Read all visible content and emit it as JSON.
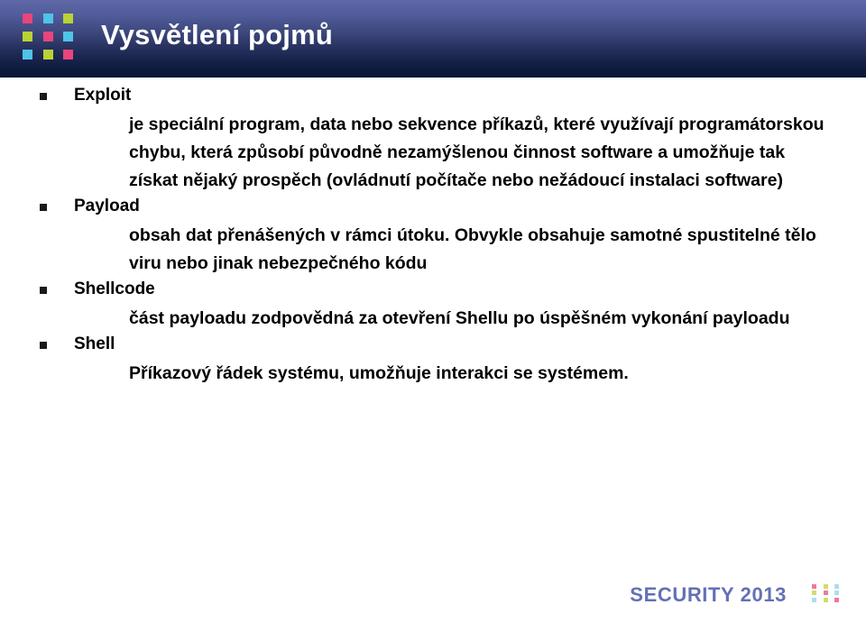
{
  "slide": {
    "header": {
      "title": "Vysvětlení pojmů",
      "logo_name": "dot-grid-logo",
      "logo_colors": [
        [
          "#e8457c",
          "#4fc3e8",
          "#b9d234"
        ],
        [
          "#b9d234",
          "#e8457c",
          "#4fc3e8"
        ],
        [
          "#4fc3e8",
          "#b9d234",
          "#e8457c"
        ]
      ],
      "gradient_top": "#5e68a6",
      "gradient_bottom": "#0a1733",
      "title_color": "#ffffff"
    },
    "terms": [
      {
        "term": "Exploit",
        "definition": "je speciální program, data nebo sekvence příkazů, které využívají programátorskou chybu, která způsobí původně nezamýšlenou činnost software a umožňuje tak získat nějaký prospěch (ovládnutí počítače nebo nežádoucí instalaci software)"
      },
      {
        "term": "Payload",
        "definition": "obsah dat přenášených v rámci útoku. Obvykle obsahuje samotné spustitelné tělo viru nebo jinak nebezpečného kódu"
      },
      {
        "term": "Shellcode",
        "definition": "část payloadu zodpovědná za otevření Shellu po úspěšném vykonání payloadu"
      },
      {
        "term": "Shell",
        "definition": "Příkazový řádek systému, umožňuje interakci se systémem."
      }
    ],
    "footer": {
      "brand": "SECURITY 2013",
      "brand_color": "#6370b5",
      "dots_name": "dot-grid-mark",
      "dots_colors": [
        [
          "#e8457c",
          "#b9d234",
          "#8fcfe8"
        ],
        [
          "#b9d234",
          "#e8457c",
          "#8fcfe8"
        ],
        [
          "#8fcfe8",
          "#b9d234",
          "#e8457c"
        ]
      ]
    }
  }
}
